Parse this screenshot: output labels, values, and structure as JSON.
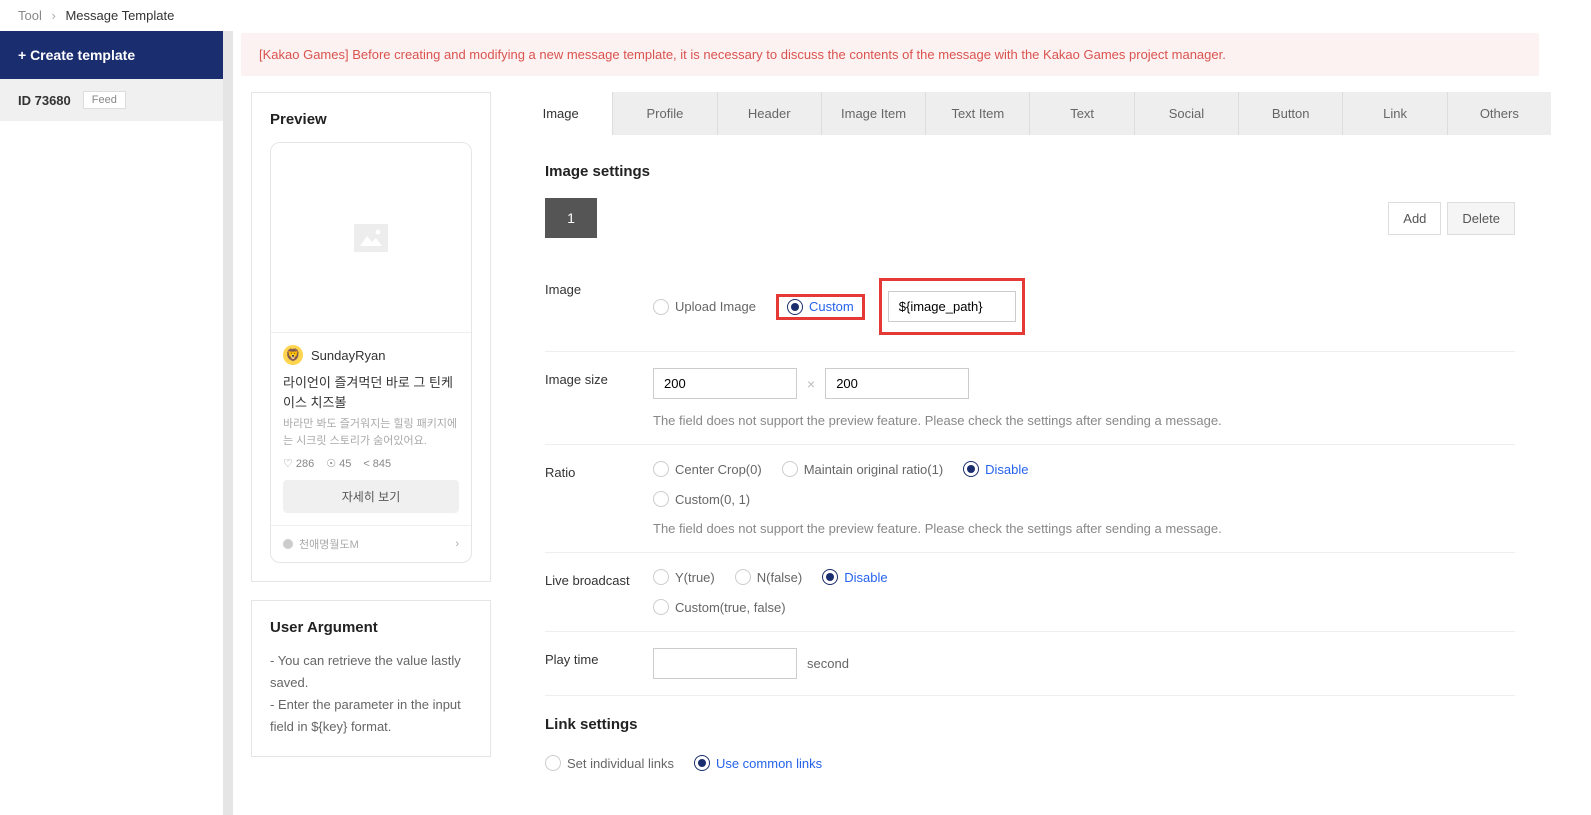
{
  "breadcrumb": {
    "root": "Tool",
    "current": "Message Template"
  },
  "sidebar": {
    "create": "+ Create template",
    "id": "ID 73680",
    "feed": "Feed"
  },
  "alert": "[Kakao Games] Before creating and modifying a new message template, it is necessary to discuss the contents of the message with the Kakao Games project manager.",
  "preview": {
    "title": "Preview",
    "author": "SundayRyan",
    "headline": "라이언이 즐겨먹던 바로 그 틴케이스 치즈볼",
    "sub": "바라만 봐도 즐거워지는 힐링 패키지에는 시크릿 스토리가 숨어있어요.",
    "likes": "286",
    "comments": "45",
    "shares": "845",
    "button": "자세히 보기",
    "footer": "천애명월도M"
  },
  "userArg": {
    "title": "User Argument",
    "line1": "- You can retrieve the value lastly saved.",
    "line2": "- Enter the parameter in the input field in ${key} format."
  },
  "tabs": [
    "Image",
    "Profile",
    "Header",
    "Image Item",
    "Text Item",
    "Text",
    "Social",
    "Button",
    "Link",
    "Others"
  ],
  "form": {
    "sectionImage": "Image settings",
    "sectionLink": "Link settings",
    "num": "1",
    "add": "Add",
    "delete": "Delete",
    "labels": {
      "image": "Image",
      "imageSize": "Image size",
      "ratio": "Ratio",
      "live": "Live broadcast",
      "play": "Play time"
    },
    "image": {
      "upload": "Upload Image",
      "custom": "Custom",
      "path": "${image_path}"
    },
    "size": {
      "w": "200",
      "h": "200"
    },
    "helper": "The field does not support the preview feature. Please check the settings after sending a message.",
    "ratio": {
      "crop": "Center Crop(0)",
      "maintain": "Maintain original ratio(1)",
      "disable": "Disable",
      "custom": "Custom(0, 1)"
    },
    "live": {
      "y": "Y(true)",
      "n": "N(false)",
      "disable": "Disable",
      "custom": "Custom(true, false)"
    },
    "play": {
      "unit": "second",
      "value": ""
    },
    "link": {
      "individual": "Set individual links",
      "common": "Use common links"
    }
  }
}
